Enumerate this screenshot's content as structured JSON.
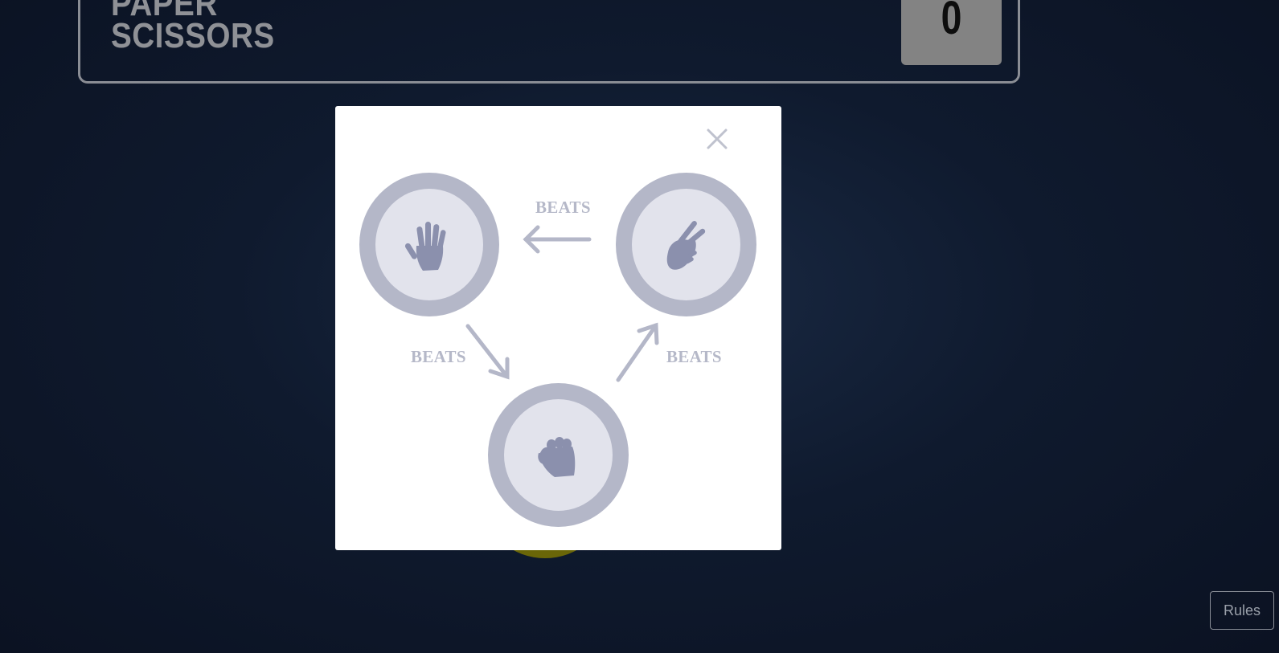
{
  "header": {
    "title_line_1": "PAPER",
    "title_line_2": "SCISSORS",
    "score_value": "0"
  },
  "rules_button": {
    "label": "Rules"
  },
  "rules_modal": {
    "close_icon": "close-icon",
    "tokens": [
      {
        "name": "paper",
        "icon": "paper-hand-icon"
      },
      {
        "name": "scissors",
        "icon": "scissors-hand-icon"
      },
      {
        "name": "rock",
        "icon": "rock-fist-icon"
      }
    ],
    "beats_labels": {
      "scissors_paper": "BEATS",
      "paper_rock": "BEATS",
      "rock_scissors": "BEATS"
    }
  },
  "colors": {
    "background": "#0f1a2e",
    "modal": "#ffffff",
    "token_ring": "#b4b7c8",
    "token_inner": "#e2e3ec",
    "icon": "#8b90ad",
    "beats_text": "#b5b8c8"
  }
}
